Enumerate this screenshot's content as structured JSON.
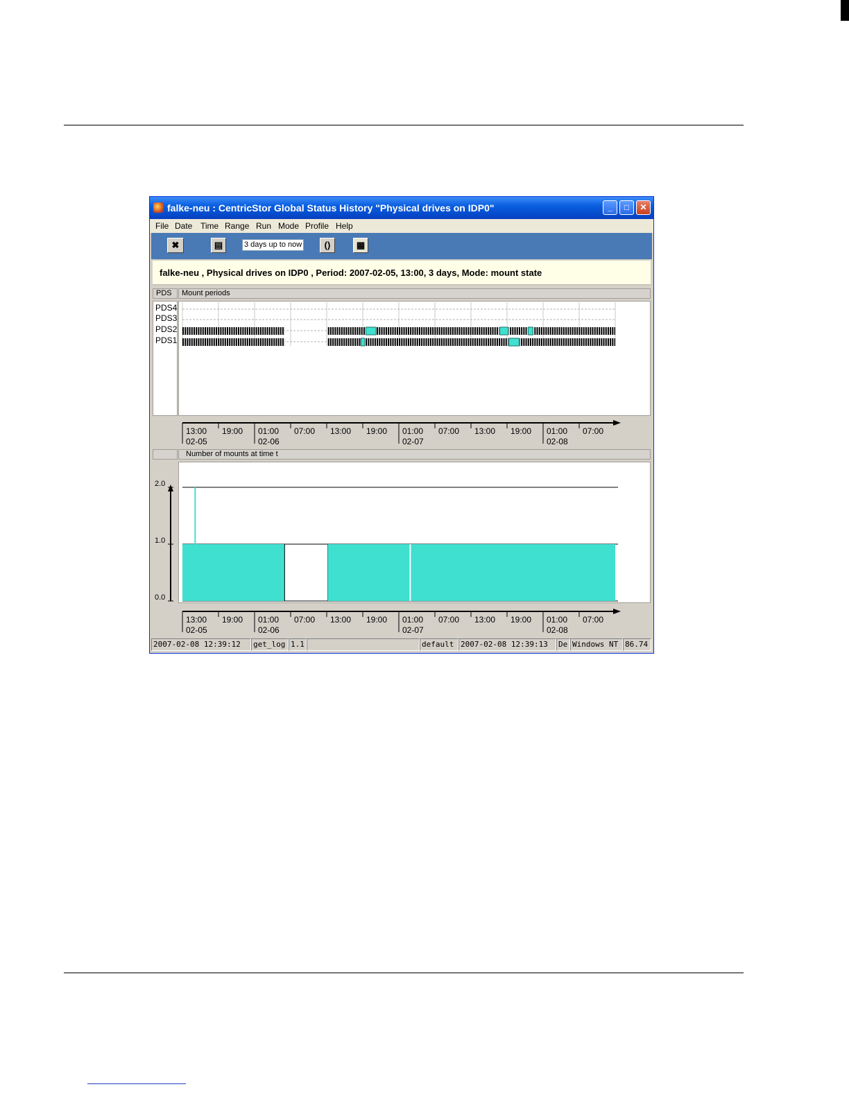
{
  "window": {
    "title": "falke-neu : CentricStor Global Status History \"Physical drives on IDP0\""
  },
  "menu": [
    "File",
    "Date",
    "Time",
    "Range",
    "Run",
    "Mode",
    "Profile",
    "Help"
  ],
  "toolbar": {
    "range_value": "3 days up to now",
    "icons": [
      "exit-icon",
      "print-icon",
      "refresh-icon",
      "calendar-icon"
    ]
  },
  "info": {
    "text": "falke-neu , Physical drives on IDP0 , Period: 2007-02-05, 13:00, 3 days, Mode: mount state"
  },
  "mount_panel": {
    "label_header": "PDS",
    "header": "Mount periods",
    "rows": [
      "PDS4",
      "PDS3",
      "PDS2",
      "PDS1"
    ]
  },
  "count_panel": {
    "header": "Number of mounts at time t"
  },
  "time_axis": {
    "ticks": [
      {
        "time": "13:00",
        "date": "02-05"
      },
      {
        "time": "19:00",
        "date": ""
      },
      {
        "time": "01:00",
        "date": "02-06"
      },
      {
        "time": "07:00",
        "date": ""
      },
      {
        "time": "13:00",
        "date": ""
      },
      {
        "time": "19:00",
        "date": ""
      },
      {
        "time": "01:00",
        "date": "02-07"
      },
      {
        "time": "07:00",
        "date": ""
      },
      {
        "time": "13:00",
        "date": ""
      },
      {
        "time": "19:00",
        "date": ""
      },
      {
        "time": "01:00",
        "date": "02-08"
      },
      {
        "time": "07:00",
        "date": ""
      }
    ]
  },
  "chart_data": {
    "type": "area",
    "title": "Number of mounts at time t",
    "x_unit": "hours since 2007-02-05 13:00",
    "ylim": [
      0,
      2
    ],
    "y_ticks": [
      "0.0",
      "1.0",
      "2.0"
    ],
    "xlim": [
      0,
      72
    ],
    "segments": [
      {
        "start": 0,
        "end": 17,
        "value": 1
      },
      {
        "start": 17,
        "end": 24.2,
        "value": 0
      },
      {
        "start": 24.2,
        "end": 37.8,
        "value": 1
      },
      {
        "start": 37.8,
        "end": 38.0,
        "value": 0
      },
      {
        "start": 38.0,
        "end": 72,
        "value": 1
      }
    ],
    "spikes": [
      {
        "at": 2.0,
        "value": 2
      }
    ],
    "mount_periods": {
      "PDS2": [
        [
          0,
          17
        ],
        [
          24.2,
          72
        ]
      ],
      "PDS1": [
        [
          0,
          17
        ],
        [
          24.2,
          72
        ]
      ],
      "PDS3": [],
      "PDS4": []
    },
    "long_mounts": {
      "PDS2": [
        [
          30.5,
          32.2
        ],
        [
          52.8,
          54.2
        ],
        [
          57.5,
          58.3
        ]
      ],
      "PDS1": [
        [
          29.7,
          30.3
        ],
        [
          54.3,
          56.0
        ]
      ]
    }
  },
  "status": {
    "left_time": "2007-02-08 12:39:12",
    "module": "get_log",
    "version": "1.1",
    "profile": "default",
    "right_time": "2007-02-08 12:39:13",
    "lang": "De",
    "os": "Windows NT",
    "value": "86.74"
  },
  "colors": {
    "fill": "#40e0d0",
    "titlebar": "#0a5fe0",
    "toolbar": "#4a7ab5"
  }
}
